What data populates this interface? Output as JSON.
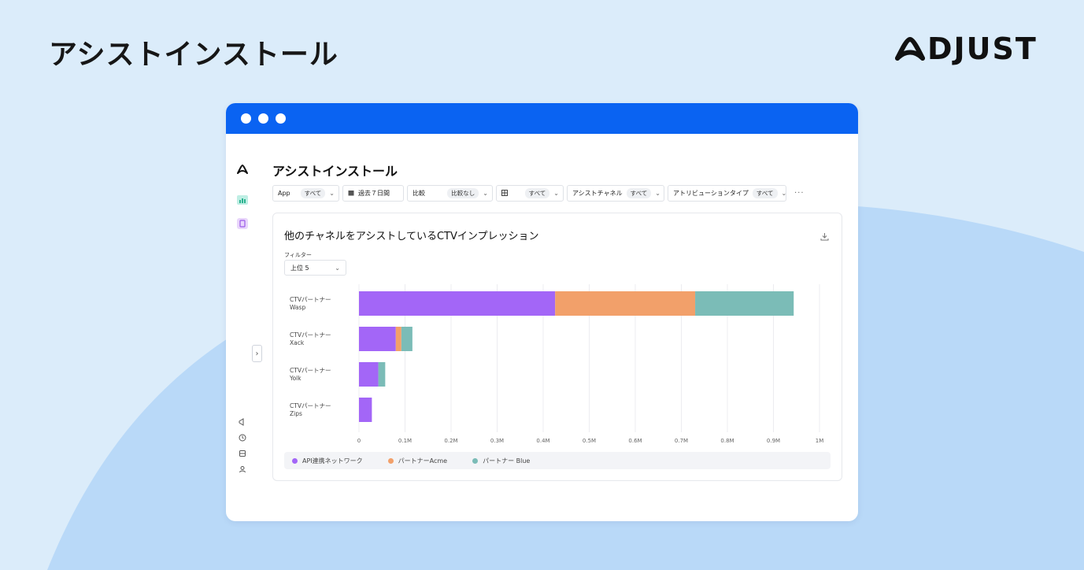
{
  "header": {
    "title": "アシストインストール",
    "logo_text": "DJUST"
  },
  "window": {
    "main_title": "アシストインストール",
    "filters": [
      {
        "label": "App",
        "value": "すべて"
      },
      {
        "label": "過去７日間",
        "value": ""
      },
      {
        "label": "比較",
        "value": "比較なし"
      },
      {
        "label": "",
        "value": "すべて"
      },
      {
        "label": "アシストチャネル",
        "value": "すべて"
      },
      {
        "label": "アトリビューションタイプ",
        "value": "すべて"
      }
    ],
    "more": "···",
    "card": {
      "title": "他のチャネルをアシストしているCTVインプレッション",
      "filter_label": "フィルター",
      "filter_value": "上位 5"
    }
  },
  "colors": {
    "brand_blue": "#0a63f2",
    "purple": "#a366f7",
    "orange": "#f2a06a",
    "teal": "#7bbcb7",
    "page_bg": "#dbecfa",
    "shape": "#b9d9f8"
  },
  "chart_data": {
    "type": "bar",
    "orientation": "horizontal",
    "stacked": true,
    "categories": [
      [
        "CTVパートナー",
        "Wasp"
      ],
      [
        "CTVパートナー",
        "Xack"
      ],
      [
        "CTVパートナー",
        "Yolk"
      ],
      [
        "CTVパートナー",
        "Zips"
      ]
    ],
    "series": [
      {
        "name": "API連携ネットワーク",
        "color": "#a366f7",
        "values": [
          426000,
          80000,
          42000,
          28000
        ]
      },
      {
        "name": "パートナーAcme",
        "color": "#f2a06a",
        "values": [
          304000,
          12000,
          0,
          0
        ]
      },
      {
        "name": "パートナー Blue",
        "color": "#7bbcb7",
        "values": [
          214000,
          24000,
          15000,
          0
        ]
      }
    ],
    "xlim": [
      0,
      1000000
    ],
    "xticks": [
      "0",
      "0.1M",
      "0.2M",
      "0.3M",
      "0.4M",
      "0.5M",
      "0.6M",
      "0.7M",
      "0.8M",
      "0.9M",
      "1M"
    ],
    "grid": true,
    "legend": "bottom"
  }
}
